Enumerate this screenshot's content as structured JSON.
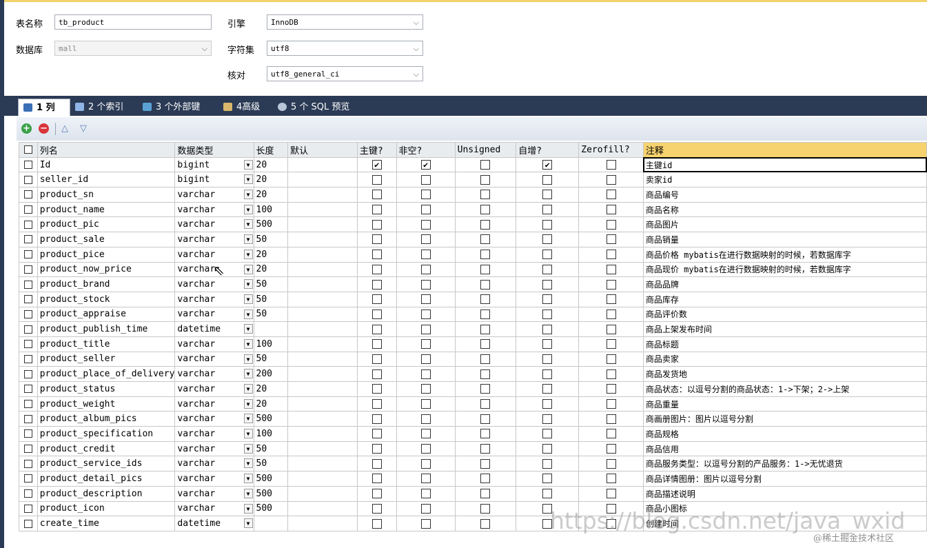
{
  "form": {
    "table_name_label": "表名称",
    "table_name_value": "tb_product",
    "database_label": "数据库",
    "database_value": "mall",
    "engine_label": "引擎",
    "engine_value": "InnoDB",
    "charset_label": "字符集",
    "charset_value": "utf8",
    "collation_label": "核对",
    "collation_value": "utf8_general_ci"
  },
  "tabs": [
    {
      "label": "1 列",
      "active": true,
      "icon": "columns-icon"
    },
    {
      "label": "2 个索引",
      "active": false,
      "icon": "index-icon"
    },
    {
      "label": "3 个外部键",
      "active": false,
      "icon": "foreign-key-icon"
    },
    {
      "label": "4高级",
      "active": false,
      "icon": "advanced-icon"
    },
    {
      "label": "5 个 SQL 预览",
      "active": false,
      "icon": "sql-preview-icon"
    }
  ],
  "toolbar": {
    "add": "+",
    "remove": "−",
    "up": "△",
    "down": "▽"
  },
  "columns": {
    "name": "列名",
    "type": "数据类型",
    "length": "长度",
    "default": "默认",
    "pk": "主键?",
    "notnull": "非空?",
    "unsigned": "Unsigned",
    "autoinc": "自增?",
    "zerofill": "Zerofill?",
    "comment": "注释"
  },
  "rows": [
    {
      "name": "Id",
      "type": "bigint",
      "length": "20",
      "default": "",
      "pk": true,
      "notnull": true,
      "unsigned": false,
      "autoinc": true,
      "zerofill": false,
      "comment": "主键id"
    },
    {
      "name": "seller_id",
      "type": "bigint",
      "length": "20",
      "default": "",
      "pk": false,
      "notnull": false,
      "unsigned": false,
      "autoinc": false,
      "zerofill": false,
      "comment": "卖家id"
    },
    {
      "name": "product_sn",
      "type": "varchar",
      "length": "20",
      "default": "",
      "pk": false,
      "notnull": false,
      "unsigned": false,
      "autoinc": false,
      "zerofill": false,
      "comment": "商品编号"
    },
    {
      "name": "product_name",
      "type": "varchar",
      "length": "100",
      "default": "",
      "pk": false,
      "notnull": false,
      "unsigned": false,
      "autoinc": false,
      "zerofill": false,
      "comment": "商品名称"
    },
    {
      "name": "product_pic",
      "type": "varchar",
      "length": "500",
      "default": "",
      "pk": false,
      "notnull": false,
      "unsigned": false,
      "autoinc": false,
      "zerofill": false,
      "comment": "商品图片"
    },
    {
      "name": "product_sale",
      "type": "varchar",
      "length": "50",
      "default": "",
      "pk": false,
      "notnull": false,
      "unsigned": false,
      "autoinc": false,
      "zerofill": false,
      "comment": "商品销量"
    },
    {
      "name": "product_pice",
      "type": "varchar",
      "length": "20",
      "default": "",
      "pk": false,
      "notnull": false,
      "unsigned": false,
      "autoinc": false,
      "zerofill": false,
      "comment": "商品价格 mybatis在进行数据映射的时候，若数据库字"
    },
    {
      "name": "product_now_price",
      "type": "varchar",
      "length": "20",
      "default": "",
      "pk": false,
      "notnull": false,
      "unsigned": false,
      "autoinc": false,
      "zerofill": false,
      "comment": "商品现价 mybatis在进行数据映射的时候，若数据库字"
    },
    {
      "name": "product_brand",
      "type": "varchar",
      "length": "50",
      "default": "",
      "pk": false,
      "notnull": false,
      "unsigned": false,
      "autoinc": false,
      "zerofill": false,
      "comment": "商品品牌"
    },
    {
      "name": "product_stock",
      "type": "varchar",
      "length": "50",
      "default": "",
      "pk": false,
      "notnull": false,
      "unsigned": false,
      "autoinc": false,
      "zerofill": false,
      "comment": "商品库存"
    },
    {
      "name": "product_appraise",
      "type": "varchar",
      "length": "50",
      "default": "",
      "pk": false,
      "notnull": false,
      "unsigned": false,
      "autoinc": false,
      "zerofill": false,
      "comment": "商品评价数"
    },
    {
      "name": "product_publish_time",
      "type": "datetime",
      "length": "",
      "default": "",
      "pk": false,
      "notnull": false,
      "unsigned": false,
      "autoinc": false,
      "zerofill": false,
      "comment": "商品上架发布时间"
    },
    {
      "name": "product_title",
      "type": "varchar",
      "length": "100",
      "default": "",
      "pk": false,
      "notnull": false,
      "unsigned": false,
      "autoinc": false,
      "zerofill": false,
      "comment": "商品标题"
    },
    {
      "name": "product_seller",
      "type": "varchar",
      "length": "50",
      "default": "",
      "pk": false,
      "notnull": false,
      "unsigned": false,
      "autoinc": false,
      "zerofill": false,
      "comment": "商品卖家"
    },
    {
      "name": "product_place_of_delivery",
      "type": "varchar",
      "length": "200",
      "default": "",
      "pk": false,
      "notnull": false,
      "unsigned": false,
      "autoinc": false,
      "zerofill": false,
      "comment": "商品发货地"
    },
    {
      "name": "product_status",
      "type": "varchar",
      "length": "20",
      "default": "",
      "pk": false,
      "notnull": false,
      "unsigned": false,
      "autoinc": false,
      "zerofill": false,
      "comment": "商品状态：以逗号分割的商品状态：1->下架；2->上架"
    },
    {
      "name": "product_weight",
      "type": "varchar",
      "length": "20",
      "default": "",
      "pk": false,
      "notnull": false,
      "unsigned": false,
      "autoinc": false,
      "zerofill": false,
      "comment": "商品重量"
    },
    {
      "name": "product_album_pics",
      "type": "varchar",
      "length": "500",
      "default": "",
      "pk": false,
      "notnull": false,
      "unsigned": false,
      "autoinc": false,
      "zerofill": false,
      "comment": "商画册图片：图片以逗号分割"
    },
    {
      "name": "product_specification",
      "type": "varchar",
      "length": "100",
      "default": "",
      "pk": false,
      "notnull": false,
      "unsigned": false,
      "autoinc": false,
      "zerofill": false,
      "comment": "商品规格"
    },
    {
      "name": "product_credit",
      "type": "varchar",
      "length": "50",
      "default": "",
      "pk": false,
      "notnull": false,
      "unsigned": false,
      "autoinc": false,
      "zerofill": false,
      "comment": "商品信用"
    },
    {
      "name": "product_service_ids",
      "type": "varchar",
      "length": "50",
      "default": "",
      "pk": false,
      "notnull": false,
      "unsigned": false,
      "autoinc": false,
      "zerofill": false,
      "comment": "商品服务类型：以逗号分割的产品服务：1->无忧退货"
    },
    {
      "name": "product_detail_pics",
      "type": "varchar",
      "length": "500",
      "default": "",
      "pk": false,
      "notnull": false,
      "unsigned": false,
      "autoinc": false,
      "zerofill": false,
      "comment": "商品详情图册：图片以逗号分割"
    },
    {
      "name": "product_description",
      "type": "varchar",
      "length": "500",
      "default": "",
      "pk": false,
      "notnull": false,
      "unsigned": false,
      "autoinc": false,
      "zerofill": false,
      "comment": "商品描述说明"
    },
    {
      "name": "product_icon",
      "type": "varchar",
      "length": "500",
      "default": "",
      "pk": false,
      "notnull": false,
      "unsigned": false,
      "autoinc": false,
      "zerofill": false,
      "comment": "商品小图标"
    },
    {
      "name": "create_time",
      "type": "datetime",
      "length": "",
      "default": "",
      "pk": false,
      "notnull": false,
      "unsigned": false,
      "autoinc": false,
      "zerofill": false,
      "comment": "创建时间"
    }
  ],
  "watermark": {
    "url": "https://blog.csdn.net/java_wxid",
    "credit": "@稀土掘金技术社区"
  }
}
